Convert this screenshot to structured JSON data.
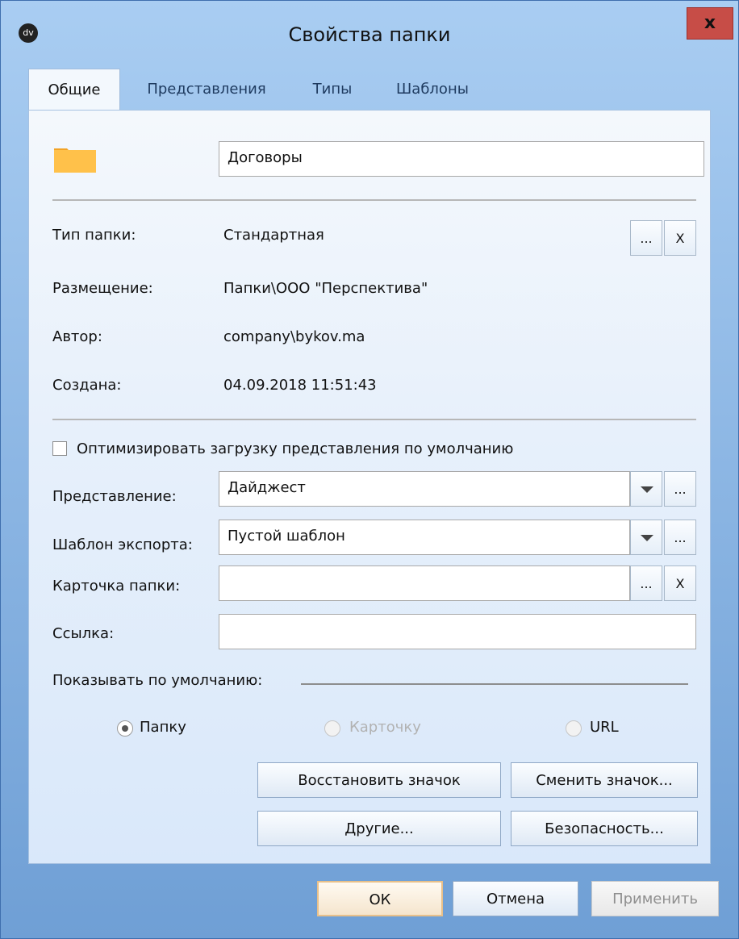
{
  "window": {
    "logo_text": "dv",
    "title": "Свойства папки",
    "close_label": "x"
  },
  "tabs": [
    {
      "label": "Общие"
    },
    {
      "label": "Представления"
    },
    {
      "label": "Типы"
    },
    {
      "label": "Шаблоны"
    }
  ],
  "general": {
    "folder_name": "Договоры",
    "folder_type": {
      "label": "Тип папки:",
      "value": "Стандартная",
      "browse_label": "...",
      "clear_label": "X"
    },
    "placement": {
      "label": "Размещение:",
      "value": "Папки\\ООО \"Перспектива\""
    },
    "author": {
      "label": "Автор:",
      "value": "company\\bykov.ma"
    },
    "created": {
      "label": "Создана:",
      "value": "04.09.2018 11:51:43"
    },
    "optimize": {
      "label": "Оптимизировать загрузку представления по умолчанию",
      "checked": false
    },
    "view": {
      "label": "Представление:",
      "value": "Дайджест",
      "browse_label": "..."
    },
    "export_template": {
      "label": "Шаблон экспорта:",
      "value": "Пустой шаблон",
      "browse_label": "..."
    },
    "folder_card": {
      "label": "Карточка папки:",
      "value": "",
      "browse_label": "...",
      "clear_label": "X"
    },
    "link": {
      "label": "Ссылка:",
      "value": ""
    },
    "show_default": {
      "label": "Показывать по умолчанию:",
      "options": [
        {
          "label": "Папку",
          "selected": true,
          "enabled": true
        },
        {
          "label": "Карточку",
          "selected": false,
          "enabled": false
        },
        {
          "label": "URL",
          "selected": false,
          "enabled": false
        }
      ]
    },
    "buttons": {
      "restore_icon": "Восстановить значок",
      "change_icon": "Сменить значок...",
      "other": "Другие...",
      "security": "Безопасность..."
    }
  },
  "footer": {
    "ok": "ОК",
    "cancel": "Отмена",
    "apply": "Применить"
  },
  "colors": {
    "folder": "#f6ac2b",
    "close": "#c74d47",
    "accent_blue": "#6f9fd5"
  },
  "icons": {
    "app": "dv-logo",
    "folder": "folder-icon",
    "dropdown": "chevron-down-icon"
  }
}
